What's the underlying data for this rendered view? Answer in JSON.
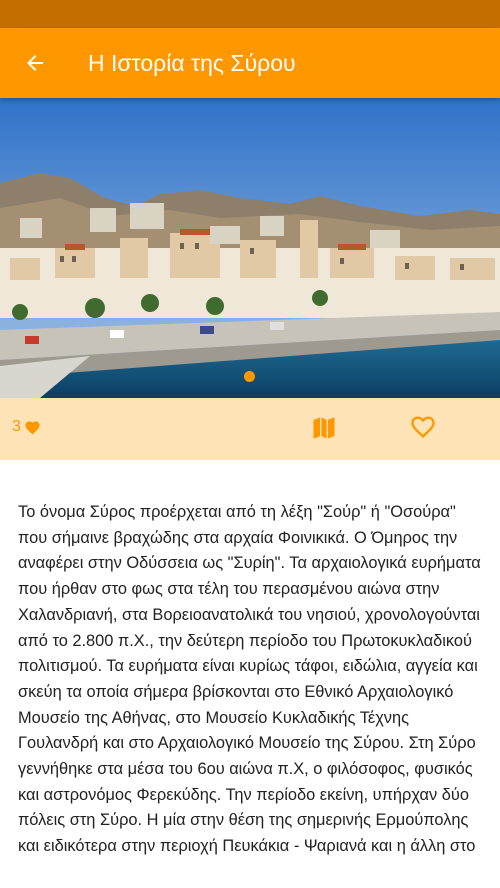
{
  "header": {
    "title": "Η Ιστορία της Σύρου",
    "back_icon": "arrow-left-icon"
  },
  "hero": {
    "image_description_icon": "harbor-photo",
    "carousel_dots": 1,
    "active_dot": 1
  },
  "actions": {
    "like_count": "3",
    "like_icon": "heart-filled-icon",
    "map_icon": "map-icon",
    "favorite_icon": "heart-outline-icon"
  },
  "article": {
    "body": "Το όνομα Σύρος προέρχεται από τη λέξη \"Σούρ\" ή \"Οσούρα\" που σήμαινε βραχώδης στα αρχαία Φοινικικά. Ο Όμηρος την αναφέρει στην Οδύσσεια ως \"Συρίη\". Τα αρχαιολογικά ευρήματα που ήρθαν στο φως στα τέλη του περασμένου αιώνα στην Χαλανδριανή, στα Βορειοανατολικά του νησιού, χρονολογούνται από το 2.800 π.Χ., την δεύτερη περίοδο του Πρωτοκυκλαδικού πολιτισμού. Τα ευρήματα είναι κυρίως τάφοι, ειδώλια, αγγεία και σκεύη τα οποία σήμερα βρίσκονται στο Εθνικό Αρχαιολογικό Μουσείο της Αθήνας, στο Μουσείο Κυκλαδικής Τέχνης Γουλανδρή και στο Αρχαιολογικό Μουσείο της Σύρου. Στη Σύρο γεννήθηκε στα μέσα του 6ου αιώνα π.Χ, ο φιλόσοφος, φυσικός και αστρονόμος Φερεκύδης. Την περίοδο εκείνη, υπήρχαν δύο πόλεις στη Σύρο. Η μία στην θέση της σημερινής Ερμούπολης και ειδικότερα στην περιοχή Πευκάκια - Ψαριανά και η άλλη στο"
  },
  "colors": {
    "primary": "#ff9800",
    "status_bar": "#c46e00",
    "action_bar_bg": "#fde3b6"
  }
}
